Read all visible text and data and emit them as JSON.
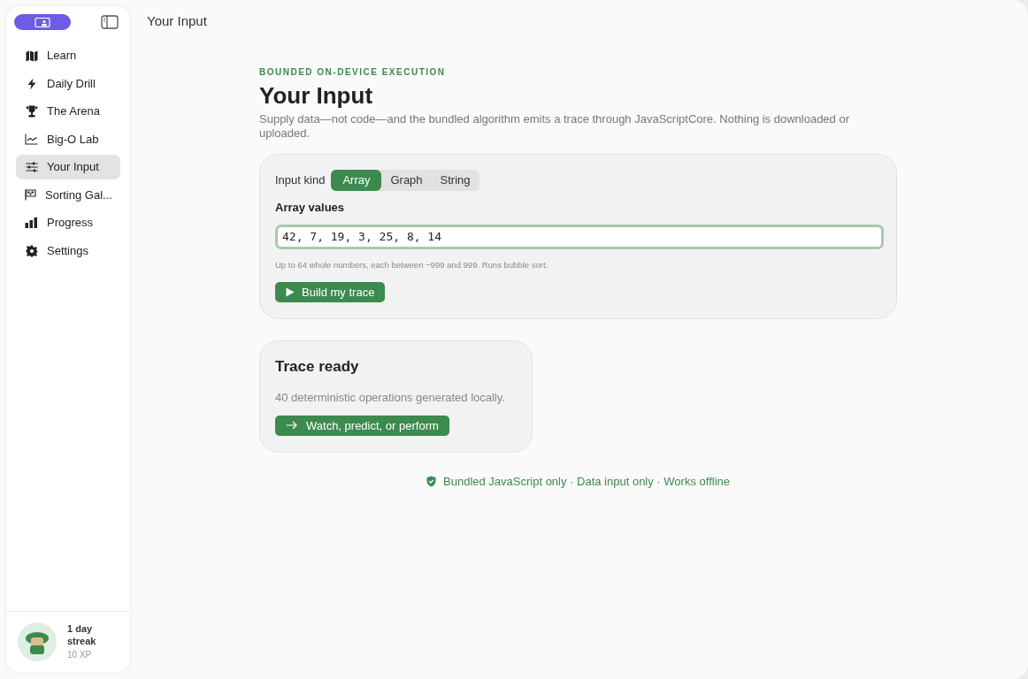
{
  "toolbar": {
    "title": "Your Input"
  },
  "sidebar": {
    "items": [
      {
        "label": "Learn",
        "selected": false
      },
      {
        "label": "Daily Drill",
        "selected": false
      },
      {
        "label": "The Arena",
        "selected": false
      },
      {
        "label": "Big-O Lab",
        "selected": false
      },
      {
        "label": "Your Input",
        "selected": true
      },
      {
        "label": "Sorting Gal...",
        "selected": false
      },
      {
        "label": "Progress",
        "selected": false
      },
      {
        "label": "Settings",
        "selected": false
      }
    ],
    "profile": {
      "streak": "1 day streak",
      "xp": "10 XP"
    }
  },
  "header": {
    "eyebrow": "BOUNDED ON-DEVICE EXECUTION",
    "title": "Your Input",
    "description": "Supply data—not code—and the bundled algorithm emits a trace through JavaScriptCore. Nothing is downloaded or uploaded."
  },
  "input_card": {
    "kind_label": "Input kind",
    "kinds": [
      {
        "label": "Array",
        "selected": true
      },
      {
        "label": "Graph",
        "selected": false
      },
      {
        "label": "String",
        "selected": false
      }
    ],
    "field_label": "Array values",
    "value": "42, 7, 19, 3, 25, 8, 14",
    "hint": "Up to 64 whole numbers, each between −999 and 999. Runs bubble sort.",
    "button": "Build my trace"
  },
  "result_card": {
    "title": "Trace ready",
    "text": "40 deterministic operations generated locally.",
    "button": "Watch, predict, or perform"
  },
  "footer": "Bundled JavaScript only · Data input only · Works offline"
}
